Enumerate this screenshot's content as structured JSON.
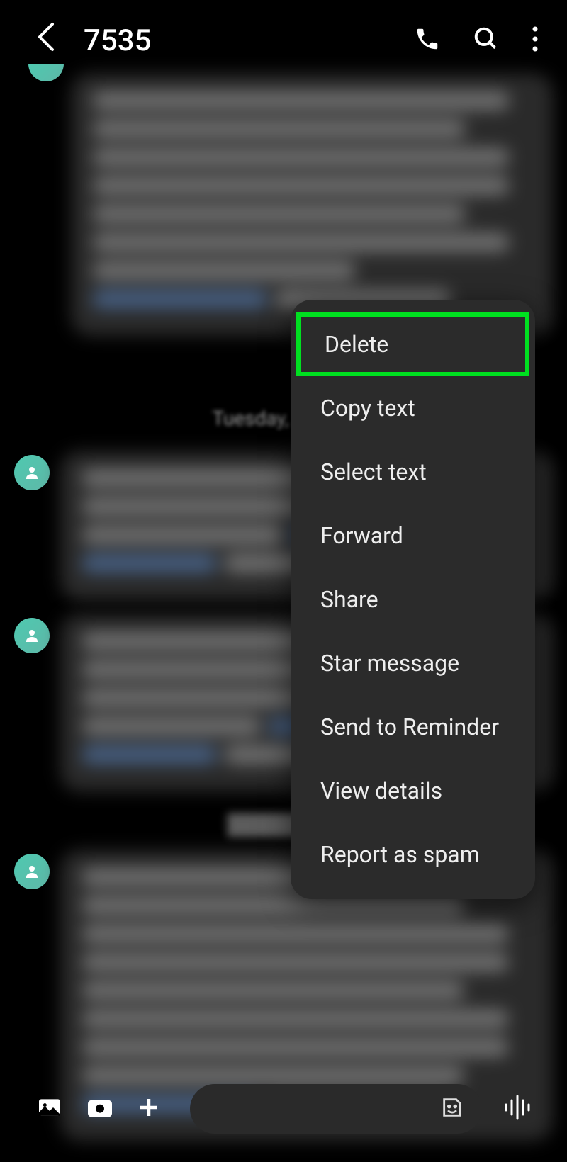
{
  "header": {
    "title": "7535"
  },
  "messages": {
    "first_timestamp": "16 PM",
    "date_divider": "Tuesday, Februa"
  },
  "context_menu": {
    "items": [
      "Delete",
      "Copy text",
      "Select text",
      "Forward",
      "Share",
      "Star message",
      "Send to Reminder",
      "View details",
      "Report as spam"
    ]
  }
}
